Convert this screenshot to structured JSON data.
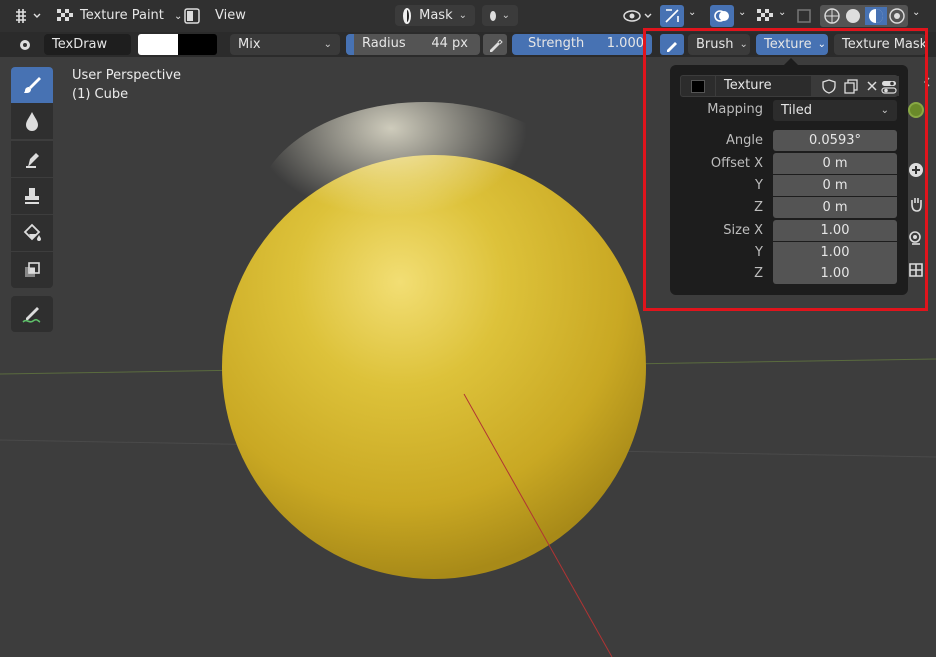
{
  "header": {
    "mode_label": "Texture Paint",
    "view_menu": "View",
    "mask_label": "Mask"
  },
  "tool_header": {
    "brush_name": "TexDraw",
    "blend_mode": "Mix",
    "radius_label": "Radius",
    "radius_value": "44 px",
    "strength_label": "Strength",
    "strength_value": "1.000",
    "brush_tab": "Brush",
    "texture_tab": "Texture",
    "texture_mask_tab": "Texture Mask",
    "primary_color": "#ffffff",
    "secondary_color": "#000000"
  },
  "viewport": {
    "perspective_label": "User Perspective",
    "object_label": "(1) Cube",
    "sphere_color": "#d8b830"
  },
  "texture_popup": {
    "texture_name": "Texture",
    "mapping_label": "Mapping",
    "mapping_value": "Tiled",
    "angle_label": "Angle",
    "angle_value": "0.0593°",
    "offset_x_label": "Offset X",
    "offset_x_value": "0 m",
    "offset_y_label": "Y",
    "offset_y_value": "0 m",
    "offset_z_label": "Z",
    "offset_z_value": "0 m",
    "size_x_label": "Size X",
    "size_x_value": "1.00",
    "size_y_label": "Y",
    "size_y_value": "1.00",
    "size_z_label": "Z",
    "size_z_value": "1.00"
  },
  "icons": {
    "editor_type": "editor-type-icon",
    "mode": "texture-paint-icon",
    "toggle": "toggle-icon",
    "mask": "mask-icon",
    "overlay": "overlay-icon",
    "gizmo": "gizmo-icon",
    "shading": "shading-icon"
  },
  "accent_color": "#4772b3",
  "highlight_color": "#e0141c"
}
